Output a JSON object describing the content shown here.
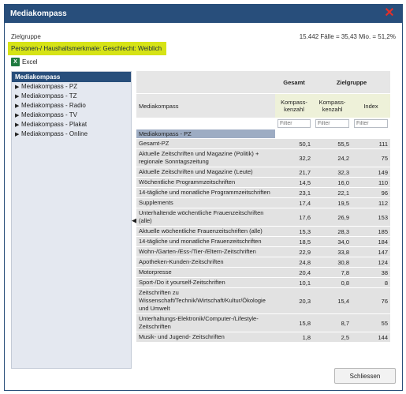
{
  "window": {
    "title": "Mediakompass"
  },
  "header": {
    "zielgruppe_label": "Zielgruppe",
    "stats": "15.442 Fälle = 35,43 Mio. = 51,2%",
    "filter_text": "Personen-/ Haushaltsmerkmale: Geschlecht: Weiblich",
    "excel_label": "Excel"
  },
  "sidebar": {
    "title": "Mediakompass",
    "items": [
      "Mediakompass - PZ",
      "Mediakompass - TZ",
      "Mediakompass - Radio",
      "Mediakompass - TV",
      "Mediakompass - Plakat",
      "Mediakompass - Online"
    ]
  },
  "table": {
    "group_headers": {
      "gesamt": "Gesamt",
      "zielgruppe": "Zielgruppe"
    },
    "row_header": "Mediakompass",
    "sub_headers": [
      "Kompass-kenzahl",
      "Kompass-kenzahl",
      "Index"
    ],
    "filter_placeholder": "Filter",
    "section": "Mediakompass - PZ",
    "rows": [
      {
        "label": "Gesamt-PZ",
        "gesamt": "50,1",
        "zg": "55,5",
        "index": "111"
      },
      {
        "label": "Aktuelle Zeitschriften und Magazine (Politik) + regionale Sonntagszeitung",
        "gesamt": "32,2",
        "zg": "24,2",
        "index": "75"
      },
      {
        "label": "Aktuelle Zeitschriften und Magazine (Leute)",
        "gesamt": "21,7",
        "zg": "32,3",
        "index": "149"
      },
      {
        "label": "Wöchentliche Programmzeitschriften",
        "gesamt": "14,5",
        "zg": "16,0",
        "index": "110"
      },
      {
        "label": "14-tägliche und monatliche Programmzeitschriften",
        "gesamt": "23,1",
        "zg": "22,1",
        "index": "96"
      },
      {
        "label": "Supplements",
        "gesamt": "17,4",
        "zg": "19,5",
        "index": "112"
      },
      {
        "label": "Unterhaltende wöchentliche Frauenzeitschriften (alle)",
        "gesamt": "17,6",
        "zg": "26,9",
        "index": "153"
      },
      {
        "label": "Aktuelle wöchentliche Frauenzeitschriften (alle)",
        "gesamt": "15,3",
        "zg": "28,3",
        "index": "185"
      },
      {
        "label": "14-tägliche und monatliche Frauenzeitschriften",
        "gesamt": "18,5",
        "zg": "34,0",
        "index": "184"
      },
      {
        "label": "Wohn-/Garten-/Ess-/Tier-/Eltern-Zeitschriften",
        "gesamt": "22,9",
        "zg": "33,8",
        "index": "147"
      },
      {
        "label": "Apotheken-Kunden-Zeitschriften",
        "gesamt": "24,8",
        "zg": "30,8",
        "index": "124"
      },
      {
        "label": "Motorpresse",
        "gesamt": "20,4",
        "zg": "7,8",
        "index": "38"
      },
      {
        "label": "Sport-/Do it yourself-Zeitschriften",
        "gesamt": "10,1",
        "zg": "0,8",
        "index": "8"
      },
      {
        "label": "Zeitschriften zu Wissenschaft/Technik/Wirtschaft/Kultur/Ökologie und Umwelt",
        "gesamt": "20,3",
        "zg": "15,4",
        "index": "76"
      },
      {
        "label": "Unterhaltungs-Elektronik/Computer-/Lifestyle-Zeitschriften",
        "gesamt": "15,8",
        "zg": "8,7",
        "index": "55"
      },
      {
        "label": "Musik- und Jugend- Zeitschriften",
        "gesamt": "1,8",
        "zg": "2,5",
        "index": "144"
      }
    ]
  },
  "footer": {
    "close_label": "Schliessen"
  }
}
